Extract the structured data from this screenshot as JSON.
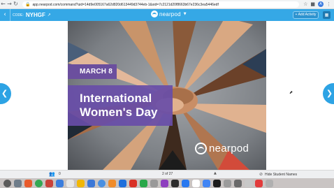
{
  "browser": {
    "url": "app.nearpod.com/command?uid=14d9e005167a62d820d613449d3744eb-1&sid=7c2121d20f8663b67e236c3ea5446edf",
    "back_icon": "arrow-left-icon",
    "forward_icon": "arrow-right-icon",
    "reload_icon": "reload-icon",
    "profile_initial": "A"
  },
  "toolbar": {
    "code_label": "CODE:",
    "code_value": "NYHGF",
    "brand": "nearpod",
    "add_activity": "+ Add Activity"
  },
  "slide": {
    "date": "MARCH 8",
    "title_line1": "International",
    "title_line2": "Women's Day",
    "logo_text": "nearpod"
  },
  "bottom": {
    "students_count": "0",
    "page_indicator": "2 of 27",
    "hide_names": "Hide Student Names"
  },
  "dock": {
    "colors": [
      "#5b5b5b",
      "#6f7d8a",
      "#e85a2b",
      "#34a853",
      "#c9423a",
      "#3b7ddd",
      "#e7e7e7",
      "#f2b705",
      "#3c78d8",
      "#4a90e2",
      "#f08c2b",
      "#1d6fdc",
      "#d93025",
      "#2aa84a",
      "#999999",
      "#8e3fbf",
      "#2c2c2c",
      "#2878f0",
      "#ffffff",
      "#4285f4",
      "#1c1c1c",
      "#9b9b9b",
      "#6a6a6a",
      "#c8c8c8",
      "#e23b3b",
      "#b0b0b0"
    ]
  },
  "colors": {
    "accent": "#35a8e6",
    "purple": "#6b4f9e"
  }
}
